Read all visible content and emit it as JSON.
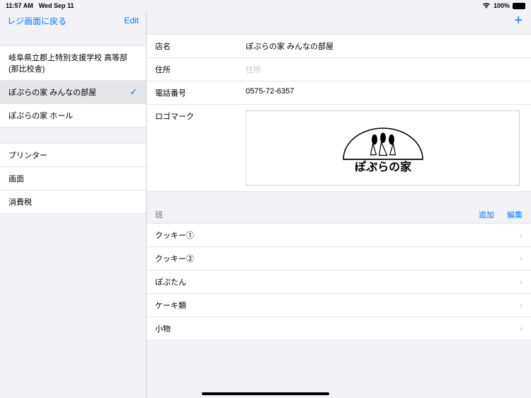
{
  "status": {
    "time": "11:57 AM",
    "date": "Wed Sep 11",
    "battery": "100%"
  },
  "sidebar": {
    "back": "レジ画面に戻る",
    "edit": "Edit",
    "stores": [
      {
        "label": "岐阜県立郡上特別支援学校 高等部(那比校舎)"
      },
      {
        "label": "ぽぷらの家 みんなの部屋"
      },
      {
        "label": "ぽぷらの家 ホール"
      }
    ],
    "settings": [
      {
        "label": "プリンター"
      },
      {
        "label": "画面"
      },
      {
        "label": "消費税"
      }
    ]
  },
  "detail": {
    "fields": {
      "name_label": "店名",
      "name_value": "ぽぷらの家 みんなの部屋",
      "address_label": "住所",
      "address_placeholder": "住所",
      "phone_label": "電話番号",
      "phone_value": "0575-72-6357",
      "logo_label": "ロゴマーク",
      "logo_text": "ぽぷらの家"
    },
    "groups": {
      "title": "班",
      "add": "追加",
      "edit": "編集",
      "items": [
        "クッキー①",
        "クッキー②",
        "ぽぷたん",
        "ケーキ類",
        "小物"
      ]
    }
  }
}
